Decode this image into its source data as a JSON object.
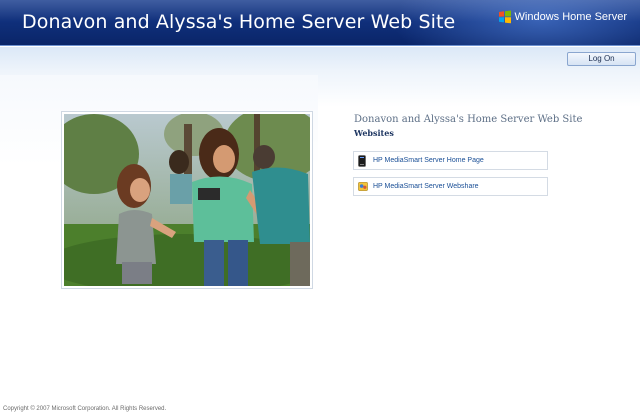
{
  "header": {
    "site_title": "Donavon and Alyssa's Home Server Web Site",
    "logo_text": "Windows Home Server",
    "brand_color": "#10307c"
  },
  "toolbar": {
    "login_label": "Log On"
  },
  "main": {
    "heading": "Donavon and Alyssa's Home Server Web Site",
    "subheading": "Websites",
    "links": [
      {
        "label": "HP MediaSmart Server Home Page",
        "icon": "server-device-icon"
      },
      {
        "label": "HP MediaSmart Server Webshare",
        "icon": "webshare-icon"
      }
    ],
    "photo": {
      "icon": "family-photo-image"
    }
  },
  "footer": {
    "copyright": "Copyright © 2007 Microsoft Corporation. All Rights Reserved."
  }
}
